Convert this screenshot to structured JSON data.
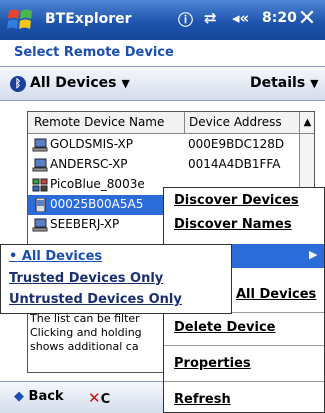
{
  "titlebar": {
    "title": "BTExplorer",
    "icons": [
      "bluetooth-status-icon",
      "connectivity-icon",
      "volume-icon"
    ],
    "clock": "8:20",
    "close": "✕",
    "status_glyphs": [
      "ⓘ",
      "⇄",
      "◂«"
    ]
  },
  "header": {
    "title": "Select Remote Device",
    "filter": "All Devices",
    "details": "Details"
  },
  "list": {
    "columns": [
      "Remote Device Name",
      "Device Address"
    ],
    "rows": [
      {
        "name": "GOLDSMIS-XP",
        "address": "000E9BDC128D",
        "icon": "computer-icon"
      },
      {
        "name": "ANDERSC-XP",
        "address": "0014A4DB1FFA",
        "icon": "computer-icon"
      },
      {
        "name": "PicoBlue_8003e",
        "address": "",
        "icon": "network-device-icon"
      },
      {
        "name": "00025B00A5A5",
        "address": "",
        "icon": "pda-device-icon"
      },
      {
        "name": "SEEBERJ-XP",
        "address": "",
        "icon": "computer-icon"
      }
    ]
  },
  "description": {
    "lines": [
      "The list can be filter",
      "Clicking and holding",
      "shows additional ca"
    ]
  },
  "context_menu": {
    "items": [
      "Discover Devices",
      "Discover Names",
      "",
      "All Devices",
      "Delete Device",
      "Properties",
      "Refresh"
    ]
  },
  "submenu": {
    "items": [
      "All Devices",
      "Trusted Devices Only",
      "Untrusted Devices Only"
    ],
    "selected_marker": "•"
  },
  "bottombar": {
    "back": "Back",
    "cancel": "C"
  },
  "colors": {
    "title_blue": "#1f55ad",
    "selection_blue": "#2c6cd9",
    "link_blue": "#1a4fb0"
  }
}
